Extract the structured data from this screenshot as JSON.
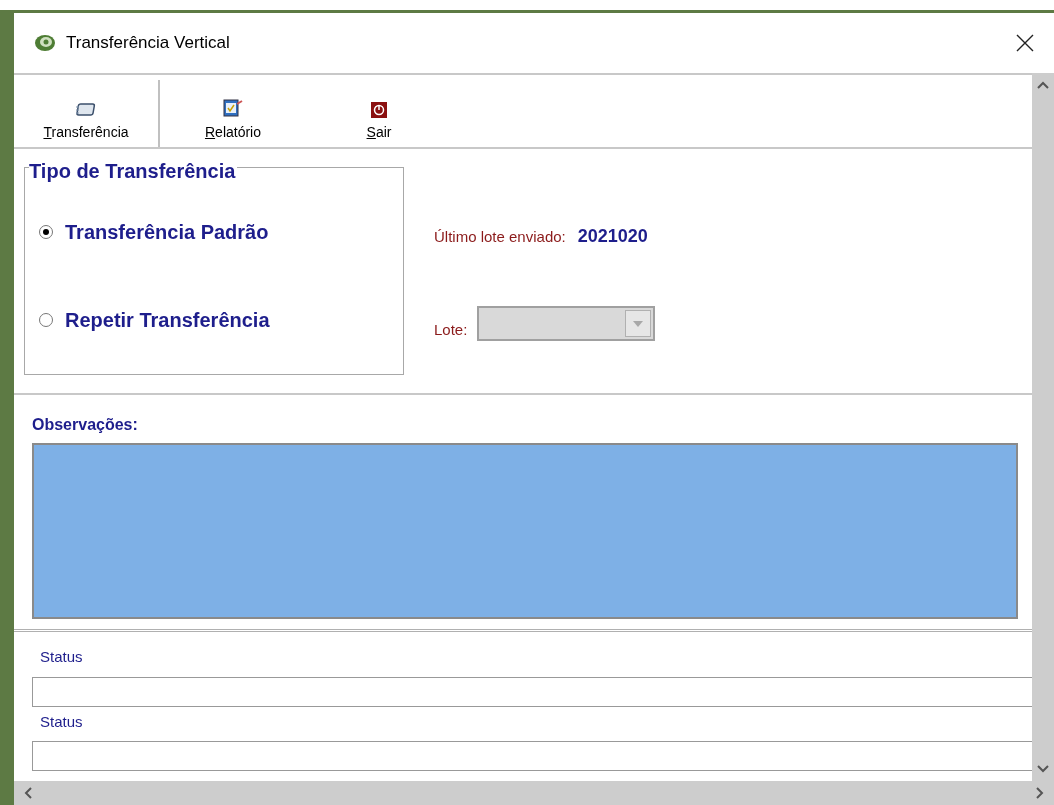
{
  "window": {
    "title": "Transferência Vertical"
  },
  "toolbar": [
    {
      "label": "Transferência",
      "selected": true,
      "kind": "transfer"
    },
    {
      "label": "Relatório",
      "selected": false,
      "kind": "report"
    },
    {
      "label": "Sair",
      "selected": false,
      "kind": "exit"
    }
  ],
  "transfer_type": {
    "title": "Tipo de Transferência",
    "options": [
      {
        "label": "Transferência Padrão",
        "selected": true
      },
      {
        "label": "Repetir Transferência",
        "selected": false
      }
    ]
  },
  "last_batch": {
    "label": "Último lote enviado:",
    "value": "2021020"
  },
  "batch": {
    "label": "Lote:",
    "disabled": true
  },
  "notes": {
    "label": "Observações:"
  },
  "status_fields": [
    {
      "label": "Status"
    },
    {
      "label": "Status"
    }
  ]
}
